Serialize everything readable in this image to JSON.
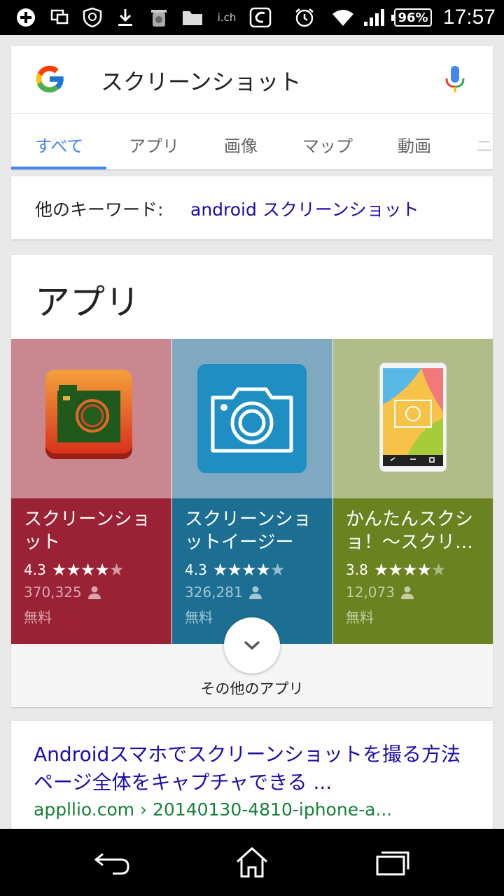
{
  "status_bar": {
    "battery": "96%",
    "time": "17:57",
    "carrier_label": "i.ch"
  },
  "search": {
    "query": "スクリーンショット",
    "tabs": [
      {
        "label": "すべて",
        "active": true
      },
      {
        "label": "アプリ"
      },
      {
        "label": "画像"
      },
      {
        "label": "マップ"
      },
      {
        "label": "動画"
      },
      {
        "label": "ニ"
      }
    ]
  },
  "keywords": {
    "label": "他のキーワード:",
    "link": "android スクリーンショット"
  },
  "apps": {
    "title": "アプリ",
    "items": [
      {
        "name": "スクリーンショット",
        "rating": "4.3",
        "stars": 4.3,
        "downloads": "370,325",
        "price": "無料",
        "top_color": "#c98790",
        "bottom_color": "#9b2234"
      },
      {
        "name": "スクリーンショットイージー",
        "rating": "4.3",
        "stars": 4.3,
        "downloads": "326,281",
        "price": "無料",
        "top_color": "#7ea9c0",
        "bottom_color": "#1c6f92"
      },
      {
        "name": "かんたんスクショ！～スクリ…",
        "rating": "3.8",
        "stars": 3.8,
        "downloads": "12,073",
        "price": "無料",
        "top_color": "#b1bd88",
        "bottom_color": "#6b8220"
      }
    ],
    "more_label": "その他のアプリ"
  },
  "result": {
    "title": "Androidスマホでスクリーンショットを撮る方法 ページ全体をキャプチャできる ...",
    "url": "appllio.com › 20140130-4810-iphone-a..."
  },
  "colors": {
    "accent": "#4285f4",
    "link": "#1a0dab",
    "url": "#188038"
  }
}
